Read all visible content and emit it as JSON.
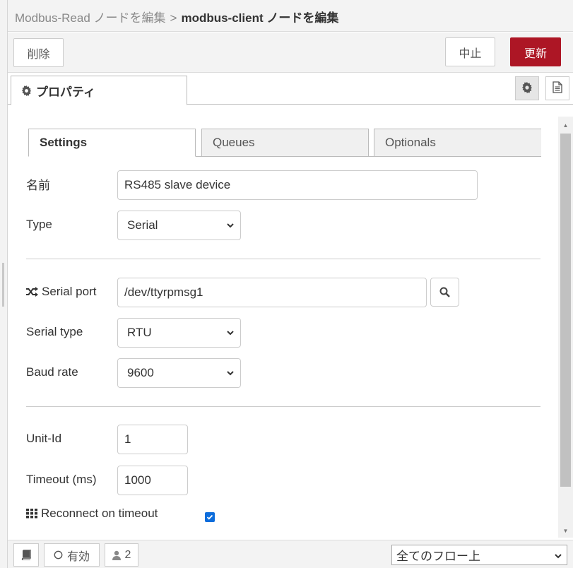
{
  "header": {
    "parent": "Modbus-Read ノードを編集",
    "separator": ">",
    "current": "modbus-client ノードを編集"
  },
  "toolbar": {
    "delete_label": "削除",
    "cancel_label": "中止",
    "update_label": "更新",
    "update_color": "#ad1625"
  },
  "tabs": {
    "properties_label": "プロパティ"
  },
  "subtabs": [
    {
      "label": "Settings",
      "active": true
    },
    {
      "label": "Queues",
      "active": false
    },
    {
      "label": "Optionals",
      "active": false
    }
  ],
  "form": {
    "name_label": "名前",
    "name_value": "RS485 slave device",
    "type_label": "Type",
    "type_value": "Serial",
    "serial_port_label": "Serial port",
    "serial_port_value": "/dev/ttyrpmsg1",
    "serial_type_label": "Serial type",
    "serial_type_value": "RTU",
    "baud_rate_label": "Baud rate",
    "baud_rate_value": "9600",
    "unit_id_label": "Unit-Id",
    "unit_id_value": "1",
    "timeout_label": "Timeout (ms)",
    "timeout_value": "1000",
    "reconnect_label": "Reconnect on timeout",
    "reconnect_checked": true
  },
  "icons": {
    "gear": "gear-icon",
    "document": "document-icon",
    "shuffle": "shuffle-icon",
    "search": "search-icon",
    "grid": "grid-icon",
    "book": "book-icon",
    "circle": "circle-icon",
    "user": "user-icon"
  },
  "footer": {
    "enabled_label": "有効",
    "users_count": "2",
    "scope_value": "全てのフロー上"
  }
}
